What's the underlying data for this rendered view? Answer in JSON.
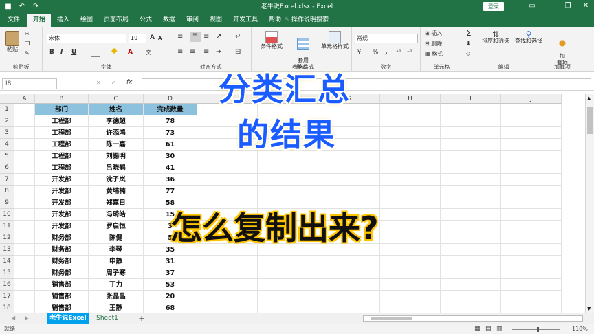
{
  "titlebar": {
    "title": "老牛说Excel.xlsx  -  Excel",
    "login": "登录",
    "undo": "↶",
    "redo": "↷",
    "save": "■",
    "minimize": "─",
    "restore": "❐",
    "close": "✕",
    "ribbon_display": "▭"
  },
  "menu": {
    "tabs": [
      "文件",
      "开始",
      "插入",
      "绘图",
      "页面布局",
      "公式",
      "数据",
      "审阅",
      "视图",
      "开发工具",
      "帮助"
    ],
    "active": "开始",
    "tellme": "操作说明搜索"
  },
  "ribbon": {
    "clipboard": {
      "label": "剪贴板",
      "paste": "粘贴"
    },
    "font": {
      "label": "字体",
      "name": "宋体",
      "size": "10",
      "bold": "B",
      "italic": "I",
      "underline": "U",
      "grow": "A",
      "shrink": "A",
      "color": "A",
      "wen": "文"
    },
    "align": {
      "label": "对齐方式"
    },
    "number": {
      "label": "数字",
      "format": "常规",
      "percent": "%",
      "comma": ","
    },
    "styles": {
      "label": "样式",
      "conditional": "条件格式",
      "table": "套用\n表格格式",
      "cell": "单元格样式"
    },
    "cells": {
      "label": "单元格",
      "insert": "插入",
      "delete": "删除",
      "format": "格式"
    },
    "editing": {
      "label": "编辑",
      "sort": "排序和筛选",
      "find": "查找和选择"
    },
    "addins": {
      "label": "加载项",
      "btn": "加\n载项"
    }
  },
  "formula_bar": {
    "name_box": "I8",
    "cancel": "✕",
    "enter": "✓",
    "fx": "fx"
  },
  "columns": [
    "A",
    "B",
    "C",
    "D",
    "E",
    "F",
    "G",
    "H",
    "I",
    "J"
  ],
  "rows": [
    "1",
    "2",
    "3",
    "4",
    "5",
    "6",
    "7",
    "8",
    "9",
    "10",
    "11",
    "12",
    "13",
    "14",
    "15",
    "16",
    "17",
    "18"
  ],
  "table": {
    "headers": [
      "部门",
      "姓名",
      "完成数量"
    ],
    "data": [
      [
        "工程部",
        "李德超",
        "78"
      ],
      [
        "工程部",
        "许添鸿",
        "73"
      ],
      [
        "工程部",
        "陈一嘉",
        "61"
      ],
      [
        "工程部",
        "刘锡明",
        "30"
      ],
      [
        "工程部",
        "吕晓鹤",
        "41"
      ],
      [
        "开发部",
        "沈子岚",
        "36"
      ],
      [
        "开发部",
        "黄埔楠",
        "77"
      ],
      [
        "开发部",
        "郑嘉日",
        "58"
      ],
      [
        "开发部",
        "冯琦皓",
        "15"
      ],
      [
        "开发部",
        "罗启恒",
        "3"
      ],
      [
        "财务部",
        "陈健",
        "5"
      ],
      [
        "财务部",
        "李琴",
        "35"
      ],
      [
        "财务部",
        "申静",
        "31"
      ],
      [
        "财务部",
        "周子寒",
        "37"
      ],
      [
        "销售部",
        "丁力",
        "53"
      ],
      [
        "销售部",
        "张晶晶",
        "20"
      ],
      [
        "销售部",
        "王静",
        "68"
      ]
    ]
  },
  "overlay": {
    "line1": "分类汇总",
    "line2": "的结果",
    "line3": "怎么复制出来?"
  },
  "sheets": {
    "tabs": [
      "老牛说Excel",
      "Sheet1"
    ],
    "active": "老牛说Excel",
    "add": "+"
  },
  "status": {
    "ready": "就绪",
    "zoom": "110%"
  },
  "colors": {
    "excel_green": "#217346",
    "header_fill": "#8dc2de",
    "active_tab": "#00a2ed"
  }
}
